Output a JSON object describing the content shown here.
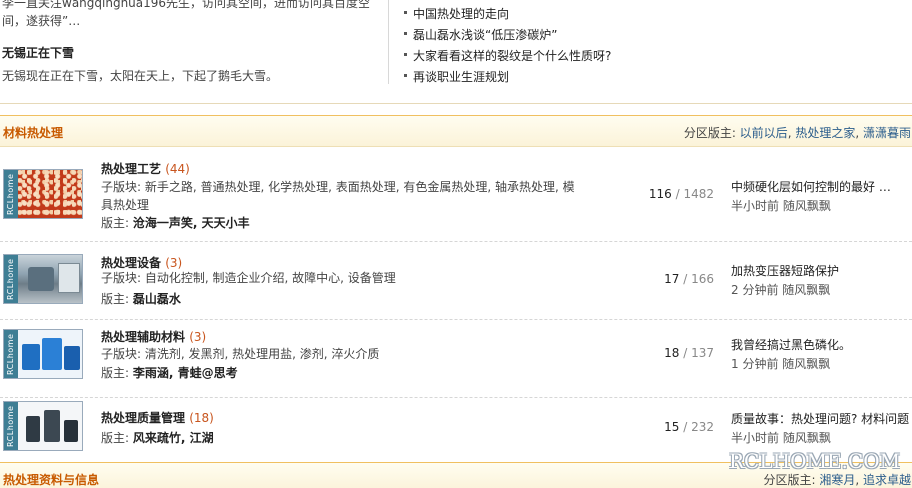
{
  "top": {
    "cut_text": "李一直关注wangqinghua196先生，访问其空间，进而访问其百度空间，遂获得”…",
    "news_title": "无锡正在下雪",
    "news_desc": "无锡现在正在下雪，太阳在天上，下起了鹅毛大雪。",
    "links": [
      "中国热处理的走向",
      "磊山磊水浅谈“低压渗碳炉”",
      "大家看看这样的裂纹是个什么性质呀?",
      "再谈职业生涯规划"
    ]
  },
  "section1": {
    "title": "材料热处理",
    "mods_label": "分区版主: ",
    "mods": [
      "以前以后",
      "热处理之家",
      "潇潇暮雨"
    ]
  },
  "forums": [
    {
      "name": "热处理工艺",
      "count": "(44)",
      "sub_label": "子版块: ",
      "subs": "新手之路, 普通热处理, 化学热处理, 表面热处理, 有色金属热处理, 轴承热处理, 模具热处理",
      "mod_label": "版主: ",
      "mods": "沧海一声笑, 天天小丰",
      "threads": "116",
      "posts": "1482",
      "last_title": "中频硬化层如何控制的最好 …",
      "last_time": "半小时前",
      "last_user": "随风飘飘",
      "thumb_label": "RCLhome"
    },
    {
      "name": "热处理设备",
      "count": "(3)",
      "sub_label": "子版块: ",
      "subs": "自动化控制, 制造企业介绍, 故障中心, 设备管理",
      "mod_label": "版主: ",
      "mods": "磊山磊水",
      "threads": "17",
      "posts": "166",
      "last_title": "加热变压器短路保护",
      "last_time": "2 分钟前",
      "last_user": "随风飘飘",
      "thumb_label": "RCLhome"
    },
    {
      "name": "热处理辅助材料",
      "count": "(3)",
      "sub_label": "子版块: ",
      "subs": "清洗剂, 发黑剂, 热处理用盐, 渗剂, 淬火介质",
      "mod_label": "版主: ",
      "mods": "李雨涵, 青蛙@思考",
      "threads": "18",
      "posts": "137",
      "last_title": "我曾经搞过黑色磷化。",
      "last_time": "1 分钟前",
      "last_user": "随风飘飘",
      "thumb_label": "RCLhome"
    },
    {
      "name": "热处理质量管理",
      "count": "(18)",
      "mod_label": "版主: ",
      "mods": "风来疏竹, 江湖",
      "threads": "15",
      "posts": "232",
      "last_title": "质量故事：热处理问题? 材料问题",
      "last_time": "半小时前",
      "last_user": "随风飘飘",
      "thumb_label": "RCLhome"
    }
  ],
  "section2": {
    "title": "热处理资料与信息",
    "mods_label": "分区版主: ",
    "mods": [
      "湘寒月",
      "追求卓越"
    ]
  },
  "watermark": "RCLHOME.COM",
  "colors": {
    "section_title": "#c85a00",
    "count": "#c8551e",
    "link": "#2b5d8c",
    "thumb_strip": "#3e7e94"
  }
}
